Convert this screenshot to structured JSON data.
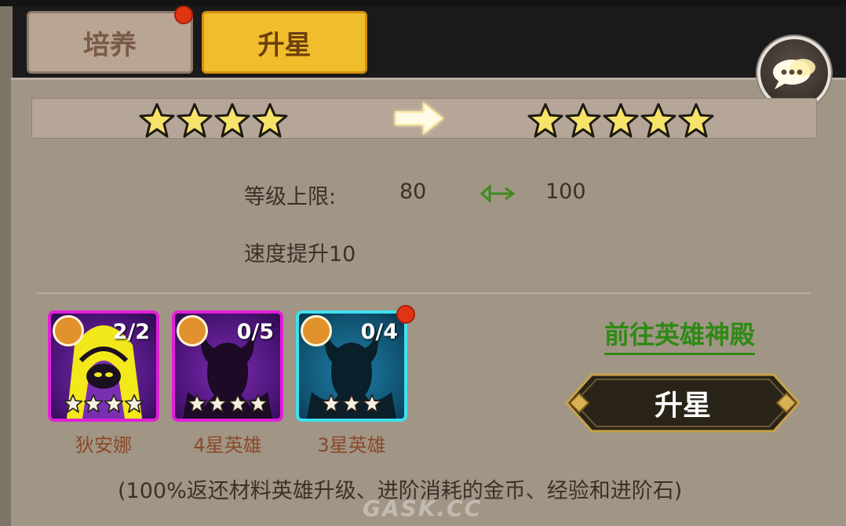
{
  "tabs": [
    {
      "label": "培养",
      "active": false,
      "has_notification": true
    },
    {
      "label": "升星",
      "active": true,
      "has_notification": false
    }
  ],
  "star_upgrade": {
    "current_stars": 4,
    "next_stars": 5
  },
  "stats": {
    "level_cap_label": "等级上限:",
    "level_cap_from": "80",
    "level_cap_to": "100",
    "bonus_text": "速度提升10"
  },
  "materials": [
    {
      "name": "狄安娜",
      "count": "2/2",
      "stars": 4,
      "frame_color": "#e21fd7",
      "notification": false
    },
    {
      "name": "4星英雄",
      "count": "0/5",
      "stars": 4,
      "frame_color": "#e21fd7",
      "notification": false
    },
    {
      "name": "3星英雄",
      "count": "0/4",
      "stars": 3,
      "frame_color": "#3ee0ee",
      "notification": true
    }
  ],
  "link_text": "前往英雄神殿",
  "upgrade_button_label": "升星",
  "footer_note": "(100%返还材料英雄升级、进阶消耗的金币、经验和进阶石)",
  "watermark": "GASK.CC",
  "icons": {
    "chat": "chat-bubbles-icon",
    "arrow": "right-arrow-icon",
    "level_arrow": "green-arrow-icon",
    "element": "sun-element-icon"
  },
  "colors": {
    "tab_active": "#f0bd2c",
    "tab_inactive": "#b8a594",
    "notification": "#e03412",
    "link": "#2e8a14",
    "button_bg": "#2a2418"
  }
}
